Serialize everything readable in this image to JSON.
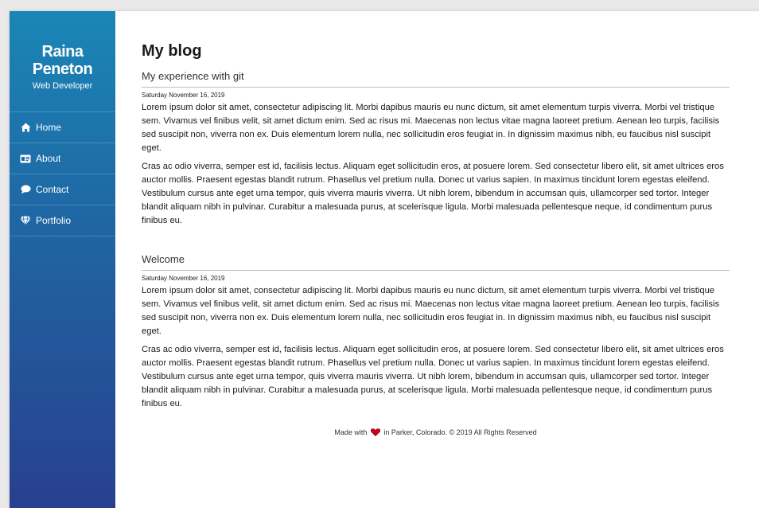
{
  "sidebar": {
    "name_line1": "Raina",
    "name_line2": "Peneton",
    "role": "Web Developer",
    "items": [
      {
        "label": "Home",
        "icon": "home-icon"
      },
      {
        "label": "About",
        "icon": "id-card-icon"
      },
      {
        "label": "Contact",
        "icon": "chat-bubble-icon"
      },
      {
        "label": "Portfolio",
        "icon": "diamond-icon"
      }
    ]
  },
  "main": {
    "title": "My blog",
    "posts": [
      {
        "title": "My experience with git",
        "date": "Saturday November 16, 2019",
        "paragraphs": [
          "Lorem ipsum dolor sit amet, consectetur adipiscing lit. Morbi dapibus mauris eu nunc dictum, sit amet elementum turpis viverra. Morbi vel tristique sem. Vivamus vel finibus velit, sit amet dictum enim. Sed ac risus mi. Maecenas non lectus vitae magna laoreet pretium. Aenean leo turpis, facilisis sed suscipit non, viverra non ex. Duis elementum lorem nulla, nec sollicitudin eros feugiat in. In dignissim maximus nibh, eu faucibus nisl suscipit eget.",
          "Cras ac odio viverra, semper est id, facilisis lectus. Aliquam eget sollicitudin eros, at posuere lorem. Sed consectetur libero elit, sit amet ultrices eros auctor mollis. Praesent egestas blandit rutrum. Phasellus vel pretium nulla. Donec ut varius sapien. In maximus tincidunt lorem egestas eleifend. Vestibulum cursus ante eget urna tempor, quis viverra mauris viverra. Ut nibh lorem, bibendum in accumsan quis, ullamcorper sed tortor. Integer blandit aliquam nibh in pulvinar. Curabitur a malesuada purus, at scelerisque ligula. Morbi malesuada pellentesque neque, id condimentum purus finibus eu."
        ]
      },
      {
        "title": "Welcome",
        "date": "Saturday November 16, 2019",
        "paragraphs": [
          "Lorem ipsum dolor sit amet, consectetur adipiscing lit. Morbi dapibus mauris eu nunc dictum, sit amet elementum turpis viverra. Morbi vel tristique sem. Vivamus vel finibus velit, sit amet dictum enim. Sed ac risus mi. Maecenas non lectus vitae magna laoreet pretium. Aenean leo turpis, facilisis sed suscipit non, viverra non ex. Duis elementum lorem nulla, nec sollicitudin eros feugiat in. In dignissim maximus nibh, eu faucibus nisl suscipit eget.",
          "Cras ac odio viverra, semper est id, facilisis lectus. Aliquam eget sollicitudin eros, at posuere lorem. Sed consectetur libero elit, sit amet ultrices eros auctor mollis. Praesent egestas blandit rutrum. Phasellus vel pretium nulla. Donec ut varius sapien. In maximus tincidunt lorem egestas eleifend. Vestibulum cursus ante eget urna tempor, quis viverra mauris viverra. Ut nibh lorem, bibendum in accumsan quis, ullamcorper sed tortor. Integer blandit aliquam nibh in pulvinar. Curabitur a malesuada purus, at scelerisque ligula. Morbi malesuada pellentesque neque, id condimentum purus finibus eu."
        ]
      }
    ]
  },
  "footer": {
    "prefix": "Made with",
    "suffix": "in Parker, Colorado. © 2019 All Rights Reserved",
    "heart_icon": "heart-icon",
    "heart_color": "#d0021b"
  },
  "colors": {
    "sidebar_top": "#1a86b6",
    "sidebar_bottom": "#28408f"
  }
}
